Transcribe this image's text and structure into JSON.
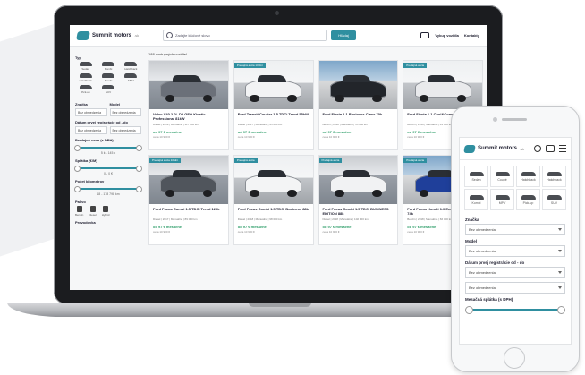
{
  "desktop": {
    "brand": "Summit motors",
    "brand_suffix": ".sk",
    "search_placeholder": "Zadajte kľúčové slovo",
    "search_button": "Hľadaj",
    "nav_sell": "Vykup vozidla",
    "nav_contact": "Kontakty",
    "result_count": "188 dostupných vozidiel",
    "filter_type_label": "Typ",
    "body_types": [
      "Sedan",
      "Kombi",
      "Hatchback",
      "Hatchback",
      "Kombi",
      "MPV",
      "Pick-up",
      "SUV"
    ],
    "filter_make_label": "Značka",
    "filter_model_label": "Model",
    "select_default": "Bez obmedzenia",
    "filter_year_label": "Dátum prvej registrácie od - do",
    "filter_price_label": "Predajná cena (s DPH)",
    "price_value": "5 k - 145 k",
    "filter_monthly_label": "Splátka (€/M)",
    "monthly_value": "0 - 0 €",
    "filter_km_label": "Počet kilometrov",
    "km_value": "18 - 178 798 km",
    "filter_fuel_label": "Palivo",
    "fuels": [
      "Benzín",
      "Diesel",
      "Hybrid"
    ],
    "filter_trans_label": "Prevodovka",
    "cars": [
      {
        "title": "Volvo V40 2.0L D2 GEO Kinetic Professional 81kW",
        "spec": "Diesel | 2019 | Manuálna | 117 000 km",
        "price": "od 97 € mesačne",
        "sub": "cena 10 900 €",
        "badge": ""
      },
      {
        "title": "Ford Transit Courier 1.5 TDCi Trend 55kW",
        "spec": "Diesel | 2017 | Manuálna | 95 000 km",
        "price": "od 97 € mesačne",
        "sub": "cena 10 900 €",
        "badge": "Predajná akcia 10 dní"
      },
      {
        "title": "Ford Fiesta 1.1 Business Class 70k",
        "spec": "Benzín | 2018 | Manuálna | 55 000 km",
        "price": "od 97 € mesačne",
        "sub": "cena 10 900 €",
        "badge": ""
      },
      {
        "title": "Ford Fiesta 1.1 Cool&Connect 55kW",
        "spec": "Benzín | 2019 | Manuálna | 44 000 km",
        "price": "od 97 € mesačne",
        "sub": "cena 10 900 €",
        "badge": "Predajná akcia"
      },
      {
        "title": "Ford Focus Combi 1.5 TDCi Trend 120k",
        "spec": "Diesel | 2017 | Manuálna | 89 000 km",
        "price": "od 97 € mesačne",
        "sub": "cena 10 900 €",
        "badge": "Predajná akcia 10 dní"
      },
      {
        "title": "Ford Focus Combi 1.5 TDCi Business 88k",
        "spec": "Diesel | 2018 | Manuálna | 98 000 km",
        "price": "od 97 € mesačne",
        "sub": "cena 10 900 €",
        "badge": "Predajná akcia"
      },
      {
        "title": "Ford Focus Combi 1.5 TDCi BUSINESS EDITION 88k",
        "spec": "Diesel | 2018 | Manuálna | 102 000 km",
        "price": "od 97 € mesačne",
        "sub": "cena 10 900 €",
        "badge": "Predajná akcia"
      },
      {
        "title": "Ford Focus Kombi 1.0 EcoBoost Trend 74k",
        "spec": "Benzín | 2018 | Manuálna | 66 000 km",
        "price": "od 97 € mesačne",
        "sub": "cena 10 900 €",
        "badge": "Predajná akcia"
      }
    ]
  },
  "mobile": {
    "brand": "Summit motors",
    "brand_suffix": ".sk",
    "body_types": [
      "Sedan",
      "Coupé",
      "Hatchback",
      "Hatchback",
      "Kombi",
      "MPV",
      "Pick-up",
      "SUV"
    ],
    "make_label": "Značka",
    "model_label": "Model",
    "year_label": "Dátum prvej registrácie od - do",
    "price_label": "Mesačná splátka (s DPH)",
    "select_default": "Bez obmedzenia"
  }
}
